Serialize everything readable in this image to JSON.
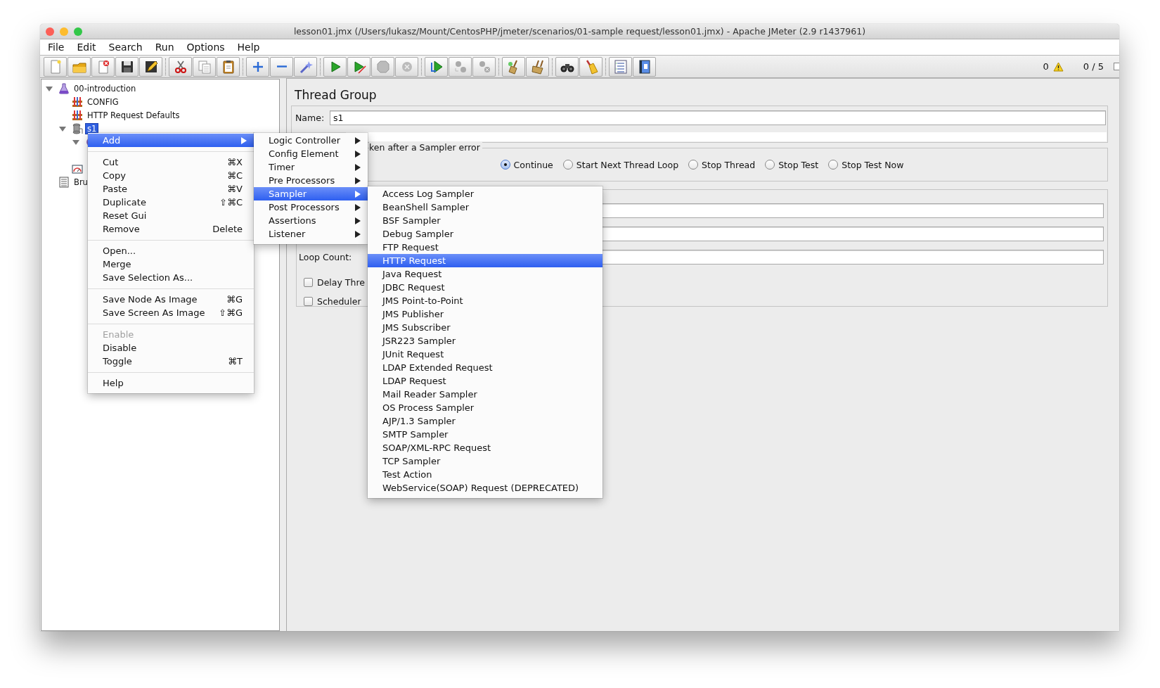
{
  "window": {
    "title": "lesson01.jmx (/Users/lukasz/Mount/CentosPHP/jmeter/scenarios/01-sample request/lesson01.jmx) - Apache JMeter (2.9 r1437961)"
  },
  "menubar": [
    "File",
    "Edit",
    "Search",
    "Run",
    "Options",
    "Help"
  ],
  "status": {
    "errors": "0",
    "threads": "0 / 5"
  },
  "tree": [
    {
      "label": "00-introduction",
      "kind": "testplan",
      "expanded": true,
      "selected": false,
      "children": [
        {
          "label": "CONFIG",
          "kind": "config",
          "selected": false
        },
        {
          "label": "HTTP Request Defaults",
          "kind": "config",
          "selected": false
        },
        {
          "label": "s1",
          "kind": "threads",
          "expanded": true,
          "selected": true,
          "children": [
            {
              "kind": "controller",
              "expanded": true
            }
          ]
        },
        {
          "kind": "listener"
        }
      ]
    },
    {
      "label": "Bru",
      "kind": "workbench",
      "selected": false
    }
  ],
  "panel": {
    "title": "Thread Group",
    "name_label": "Name:",
    "name_value": "s1",
    "error_action": {
      "legend": "ken after a Sampler error",
      "options": [
        {
          "label": "Continue",
          "selected": true
        },
        {
          "label": "Start Next Thread Loop",
          "selected": false
        },
        {
          "label": "Stop Thread",
          "selected": false
        },
        {
          "label": "Stop Test",
          "selected": false
        },
        {
          "label": "Stop Test Now",
          "selected": false
        }
      ]
    },
    "fields": [
      {
        "kind": "text"
      },
      {
        "kind": "text"
      },
      {
        "kind": "labeled",
        "label": "Loop Count:"
      }
    ],
    "checkboxes": [
      {
        "label": "Delay Thre",
        "checked": false
      },
      {
        "label": "Scheduler",
        "checked": false
      }
    ]
  },
  "context_menu": [
    {
      "kind": "item",
      "label": "Add",
      "submenu": true,
      "selected": true,
      "disabled": false
    },
    {
      "kind": "separator"
    },
    {
      "kind": "item",
      "label": "Cut",
      "shortcut": "⌘X",
      "submenu": false,
      "selected": false,
      "disabled": false
    },
    {
      "kind": "item",
      "label": "Copy",
      "shortcut": "⌘C",
      "submenu": false,
      "selected": false,
      "disabled": false
    },
    {
      "kind": "item",
      "label": "Paste",
      "shortcut": "⌘V",
      "submenu": false,
      "selected": false,
      "disabled": false
    },
    {
      "kind": "item",
      "label": "Duplicate",
      "shortcut": "⇧⌘C",
      "submenu": false,
      "selected": false,
      "disabled": false
    },
    {
      "kind": "item",
      "label": "Reset Gui",
      "submenu": false,
      "selected": false,
      "disabled": false
    },
    {
      "kind": "item",
      "label": "Remove",
      "shortcut": "Delete",
      "submenu": false,
      "selected": false,
      "disabled": false
    },
    {
      "kind": "separator"
    },
    {
      "kind": "item",
      "label": "Open...",
      "submenu": false,
      "selected": false,
      "disabled": false
    },
    {
      "kind": "item",
      "label": "Merge",
      "submenu": false,
      "selected": false,
      "disabled": false
    },
    {
      "kind": "item",
      "label": "Save Selection As...",
      "submenu": false,
      "selected": false,
      "disabled": false
    },
    {
      "kind": "separator"
    },
    {
      "kind": "item",
      "label": "Save Node As Image",
      "shortcut": "⌘G",
      "submenu": false,
      "selected": false,
      "disabled": false
    },
    {
      "kind": "item",
      "label": "Save Screen As Image",
      "shortcut": "⇧⌘G",
      "submenu": false,
      "selected": false,
      "disabled": false
    },
    {
      "kind": "separator"
    },
    {
      "kind": "item",
      "label": "Enable",
      "submenu": false,
      "selected": false,
      "disabled": true
    },
    {
      "kind": "item",
      "label": "Disable",
      "submenu": false,
      "selected": false,
      "disabled": false
    },
    {
      "kind": "item",
      "label": "Toggle",
      "shortcut": "⌘T",
      "submenu": false,
      "selected": false,
      "disabled": false
    },
    {
      "kind": "separator"
    },
    {
      "kind": "item",
      "label": "Help",
      "submenu": false,
      "selected": false,
      "disabled": false
    }
  ],
  "add_menu": [
    {
      "kind": "item",
      "label": "Logic Controller",
      "submenu": true,
      "selected": false,
      "disabled": false
    },
    {
      "kind": "item",
      "label": "Config Element",
      "submenu": true,
      "selected": false,
      "disabled": false
    },
    {
      "kind": "item",
      "label": "Timer",
      "submenu": true,
      "selected": false,
      "disabled": false
    },
    {
      "kind": "item",
      "label": "Pre Processors",
      "submenu": true,
      "selected": false,
      "disabled": false
    },
    {
      "kind": "item",
      "label": "Sampler",
      "submenu": true,
      "selected": true,
      "disabled": false
    },
    {
      "kind": "item",
      "label": "Post Processors",
      "submenu": true,
      "selected": false,
      "disabled": false
    },
    {
      "kind": "item",
      "label": "Assertions",
      "submenu": true,
      "selected": false,
      "disabled": false
    },
    {
      "kind": "item",
      "label": "Listener",
      "submenu": true,
      "selected": false,
      "disabled": false
    }
  ],
  "sampler_menu": [
    {
      "kind": "item",
      "label": "Access Log Sampler",
      "submenu": false,
      "selected": false,
      "disabled": false
    },
    {
      "kind": "item",
      "label": "BeanShell Sampler",
      "submenu": false,
      "selected": false,
      "disabled": false
    },
    {
      "kind": "item",
      "label": "BSF Sampler",
      "submenu": false,
      "selected": false,
      "disabled": false
    },
    {
      "kind": "item",
      "label": "Debug Sampler",
      "submenu": false,
      "selected": false,
      "disabled": false
    },
    {
      "kind": "item",
      "label": "FTP Request",
      "submenu": false,
      "selected": false,
      "disabled": false
    },
    {
      "kind": "item",
      "label": "HTTP Request",
      "submenu": false,
      "selected": true,
      "disabled": false
    },
    {
      "kind": "item",
      "label": "Java Request",
      "submenu": false,
      "selected": false,
      "disabled": false
    },
    {
      "kind": "item",
      "label": "JDBC Request",
      "submenu": false,
      "selected": false,
      "disabled": false
    },
    {
      "kind": "item",
      "label": "JMS Point-to-Point",
      "submenu": false,
      "selected": false,
      "disabled": false
    },
    {
      "kind": "item",
      "label": "JMS Publisher",
      "submenu": false,
      "selected": false,
      "disabled": false
    },
    {
      "kind": "item",
      "label": "JMS Subscriber",
      "submenu": false,
      "selected": false,
      "disabled": false
    },
    {
      "kind": "item",
      "label": "JSR223 Sampler",
      "submenu": false,
      "selected": false,
      "disabled": false
    },
    {
      "kind": "item",
      "label": "JUnit Request",
      "submenu": false,
      "selected": false,
      "disabled": false
    },
    {
      "kind": "item",
      "label": "LDAP Extended Request",
      "submenu": false,
      "selected": false,
      "disabled": false
    },
    {
      "kind": "item",
      "label": "LDAP Request",
      "submenu": false,
      "selected": false,
      "disabled": false
    },
    {
      "kind": "item",
      "label": "Mail Reader Sampler",
      "submenu": false,
      "selected": false,
      "disabled": false
    },
    {
      "kind": "item",
      "label": "OS Process Sampler",
      "submenu": false,
      "selected": false,
      "disabled": false
    },
    {
      "kind": "item",
      "label": "AJP/1.3 Sampler",
      "submenu": false,
      "selected": false,
      "disabled": false
    },
    {
      "kind": "item",
      "label": "SMTP Sampler",
      "submenu": false,
      "selected": false,
      "disabled": false
    },
    {
      "kind": "item",
      "label": "SOAP/XML-RPC Request",
      "submenu": false,
      "selected": false,
      "disabled": false
    },
    {
      "kind": "item",
      "label": "TCP Sampler",
      "submenu": false,
      "selected": false,
      "disabled": false
    },
    {
      "kind": "item",
      "label": "Test Action",
      "submenu": false,
      "selected": false,
      "disabled": false
    },
    {
      "kind": "item",
      "label": "WebService(SOAP) Request (DEPRECATED)",
      "submenu": false,
      "selected": false,
      "disabled": false
    }
  ]
}
